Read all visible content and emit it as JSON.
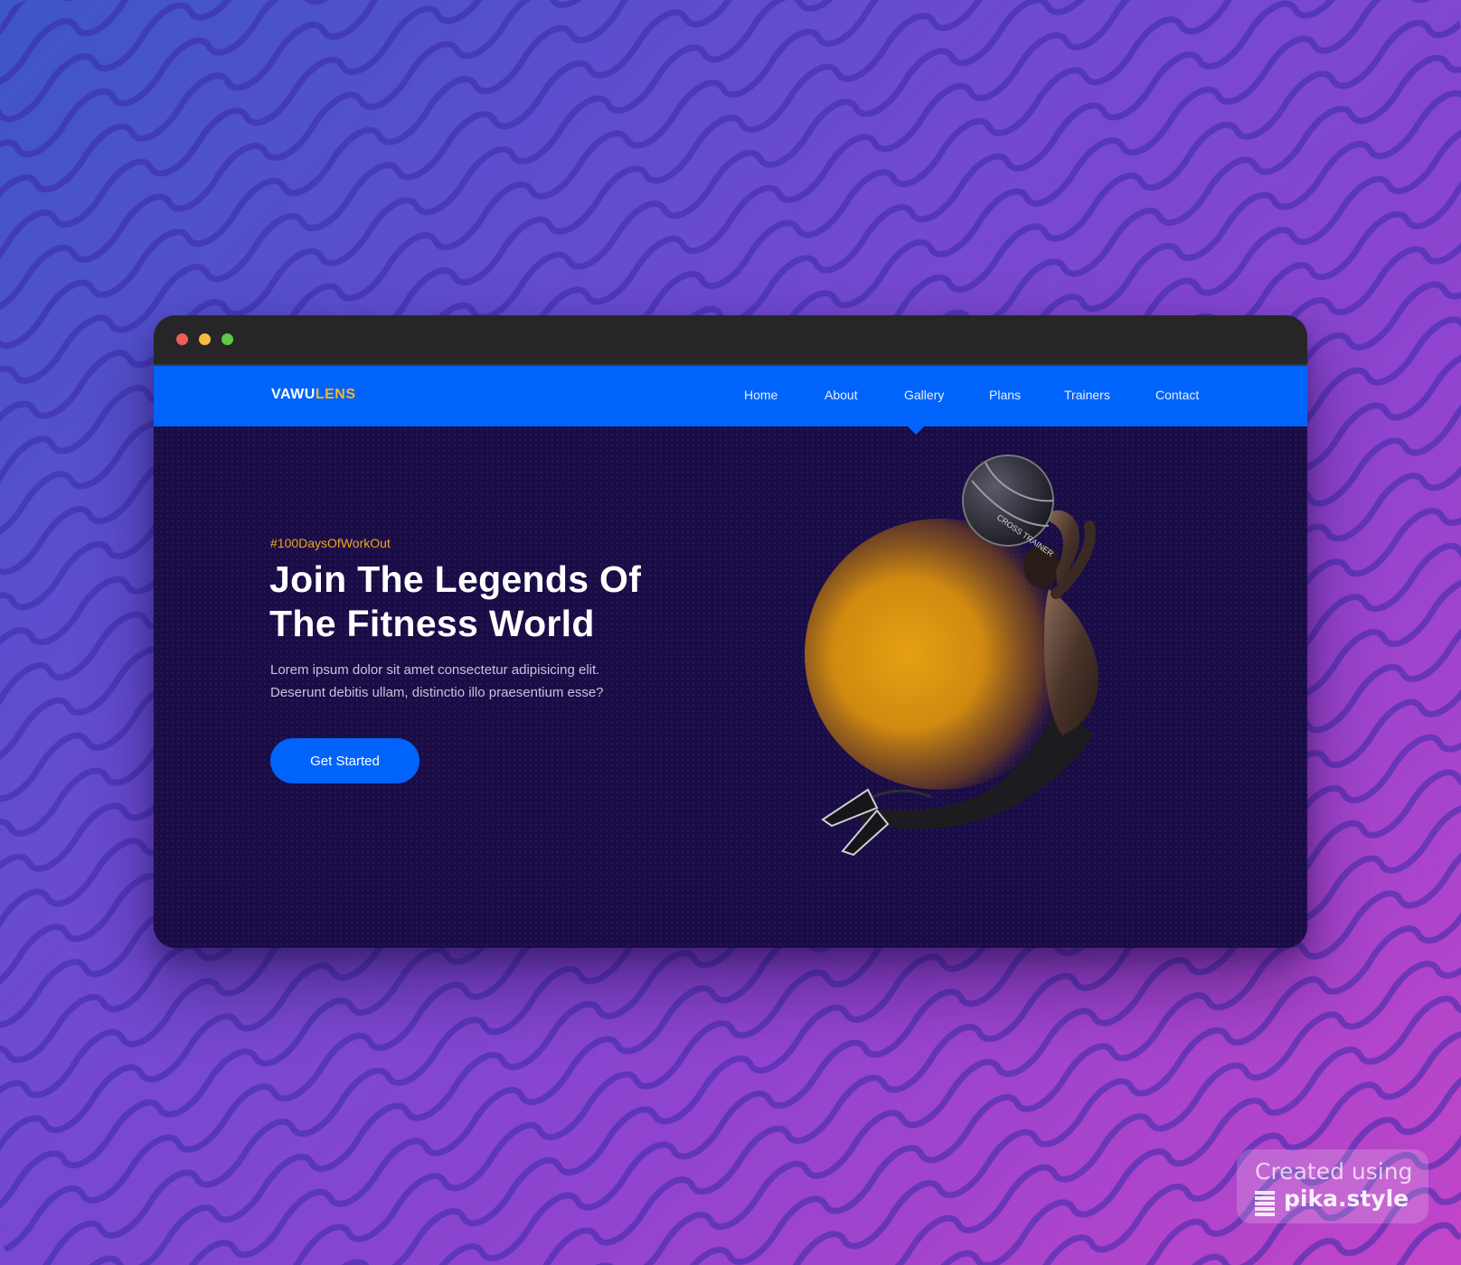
{
  "site": {
    "logo_primary": "VAWU",
    "logo_accent": "LENS",
    "nav": [
      {
        "label": "Home",
        "active": true
      },
      {
        "label": "About"
      },
      {
        "label": "Gallery"
      },
      {
        "label": "Plans"
      },
      {
        "label": "Trainers"
      },
      {
        "label": "Contact"
      }
    ]
  },
  "hero": {
    "tagline": "#100DaysOfWorkOut",
    "headline_line1": "Join The Legends Of",
    "headline_line2": "The Fitness World",
    "description_line1": "Lorem ipsum dolor sit amet consectetur adipisicing elit.",
    "description_line2": "Deserunt debitis ullam, distinctio illo praesentium esse?",
    "cta_label": "Get Started",
    "image": {
      "subject": "athlete-with-medicine-ball",
      "ball_text": "CROSS TRAINER"
    }
  },
  "watermark": {
    "line1": "Created using",
    "line2": "pika.style"
  },
  "colors": {
    "nav_blue": "#0064fc",
    "hero_bg": "#1a0c45",
    "accent_gold": "#f2a716",
    "logo_accent": "#f5b52c",
    "titlebar": "#262628"
  }
}
